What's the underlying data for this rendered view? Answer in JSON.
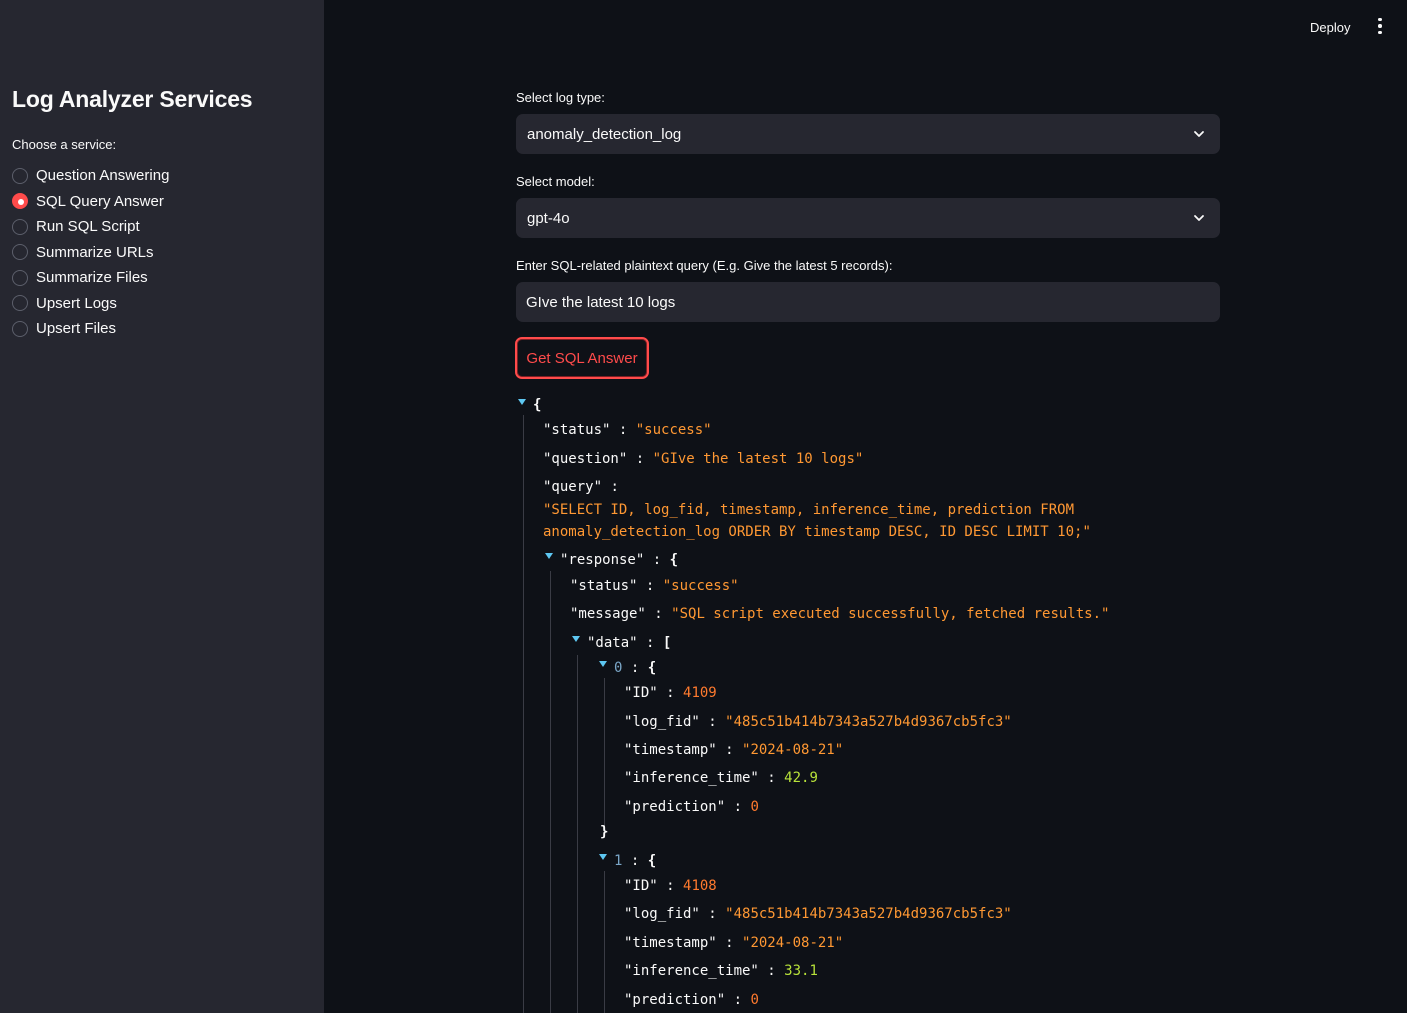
{
  "header": {
    "deploy_label": "Deploy",
    "menu_icon": "more-vertical-icon"
  },
  "sidebar": {
    "title": "Log Analyzer Services",
    "choose_label": "Choose a service:",
    "selected_index": 1,
    "items": [
      {
        "label": "Question Answering"
      },
      {
        "label": "SQL Query Answer"
      },
      {
        "label": "Run SQL Script"
      },
      {
        "label": "Summarize URLs"
      },
      {
        "label": "Summarize Files"
      },
      {
        "label": "Upsert Logs"
      },
      {
        "label": "Upsert Files"
      }
    ]
  },
  "form": {
    "log_type_label": "Select log type:",
    "log_type_value": "anomaly_detection_log",
    "model_label": "Select model:",
    "model_value": "gpt-4o",
    "query_label": "Enter SQL-related plaintext query (E.g. Give the latest 5 records):",
    "query_value": "GIve the latest 10 logs",
    "submit_label": "Get SQL Answer"
  },
  "result": {
    "status": "\"success\"",
    "question": "\"GIve the latest 10 logs\"",
    "query_line1": "\"SELECT ID, log_fid, timestamp, inference_time, prediction FROM",
    "query_line2": "anomaly_detection_log ORDER BY timestamp DESC, ID DESC LIMIT 10;\"",
    "response": {
      "status": "\"success\"",
      "message": "\"SQL script executed successfully, fetched results.\"",
      "data": [
        {
          "ID": "4109",
          "log_fid": "\"485c51b414b7343a527b4d9367cb5fc3\"",
          "timestamp": "\"2024-08-21\"",
          "inference_time": "42.9",
          "prediction": "0"
        },
        {
          "ID": "4108",
          "log_fid": "\"485c51b414b7343a527b4d9367cb5fc3\"",
          "timestamp": "\"2024-08-21\"",
          "inference_time": "33.1",
          "prediction": "0"
        }
      ]
    }
  },
  "colors": {
    "accent": "#ff4b4b",
    "string": "#ff9833",
    "number_int": "#ff7a2e",
    "number_float": "#b8e23a",
    "toggle": "#5ec8f2"
  }
}
